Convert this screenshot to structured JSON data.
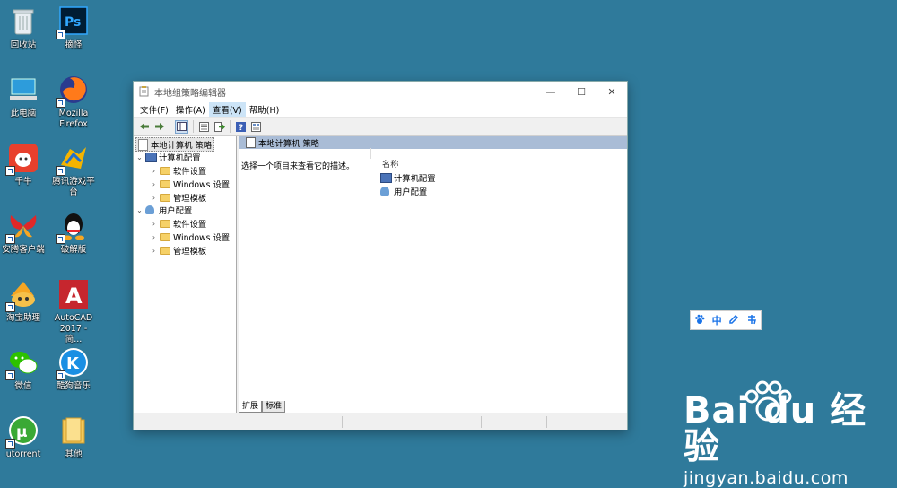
{
  "desktop": {
    "icons": [
      {
        "label": "回收站",
        "icon": "recycle-bin-icon"
      },
      {
        "label": "摘怪",
        "icon": "photoshop-icon"
      },
      {
        "label": "此电脑",
        "icon": "this-pc-icon"
      },
      {
        "label": "Mozilla Firefox",
        "icon": "firefox-icon"
      },
      {
        "label": "千牛",
        "icon": "qianniu-icon"
      },
      {
        "label": "腾讯游戏平台",
        "icon": "tencent-games-icon"
      },
      {
        "label": "安腾客户端",
        "icon": "client-icon"
      },
      {
        "label": "破解版",
        "icon": "qq-icon"
      },
      {
        "label": "淘宝助理",
        "icon": "taobao-assistant-icon"
      },
      {
        "label": "AutoCAD 2017 - 简...",
        "icon": "autocad-icon"
      },
      {
        "label": "微信",
        "icon": "wechat-icon"
      },
      {
        "label": "酷狗音乐",
        "icon": "kugou-icon"
      },
      {
        "label": "utorrent",
        "icon": "utorrent-icon"
      },
      {
        "label": "其他",
        "icon": "folder-icon"
      }
    ]
  },
  "window": {
    "title": "本地组策略编辑器",
    "menu": [
      "文件(F)",
      "操作(A)",
      "查看(V)",
      "帮助(H)"
    ],
    "active_menu_index": 2,
    "tree": {
      "root": "本地计算机 策略",
      "computer": "计算机配置",
      "computer_children": [
        "软件设置",
        "Windows 设置",
        "管理模板"
      ],
      "user": "用户配置",
      "user_children": [
        "软件设置",
        "Windows 设置",
        "管理模板"
      ]
    },
    "right": {
      "header": "本地计算机 策略",
      "description": "选择一个项目来查看它的描述。",
      "column_name": "名称",
      "items": [
        "计算机配置",
        "用户配置"
      ]
    },
    "tabs": [
      "扩展",
      "标准"
    ]
  },
  "ime": {
    "chinese_label": "中"
  },
  "watermark": {
    "brand": "Bai du 经验",
    "url": "jingyan.baidu.com"
  },
  "colors": {
    "desktop": "#2f7a9b",
    "header_bar": "#a9bcd6"
  }
}
